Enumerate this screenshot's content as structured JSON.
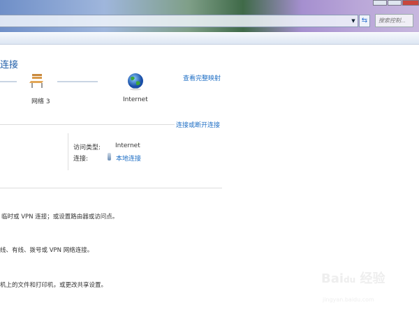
{
  "address_bar": {
    "dropdown_icon": "chevron-down-icon",
    "refresh_icon": "refresh-icon"
  },
  "search": {
    "placeholder": "搜索控制..."
  },
  "section": {
    "title": "连接"
  },
  "map": {
    "nodes": [
      {
        "label": "网络  3",
        "icon": "bench-network-icon"
      },
      {
        "label": "Internet",
        "icon": "globe-icon"
      }
    ],
    "view_full_map": "查看完整映射"
  },
  "active_network": {
    "connect_disconnect": "连接或断开连接",
    "access_type_label": "访问类型:",
    "access_type_value": "Internet",
    "connection_label": "连接:",
    "connection_value": "本地连接"
  },
  "tasks": [
    "临时或 VPN 连接；或设置路由器或访问点。",
    "线、有线、拨号或 VPN 网络连接。",
    "机上的文件和打印机，或更改共享设置。"
  ],
  "watermark": {
    "logo": "Bai du 经验",
    "url": "jingyan.baidu.com"
  }
}
